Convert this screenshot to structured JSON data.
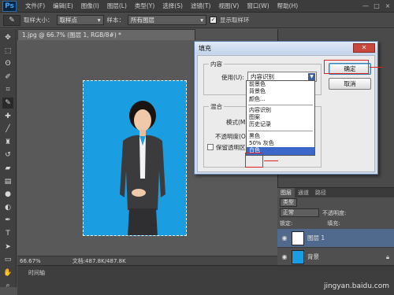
{
  "app": {
    "logo": "Ps",
    "menu": [
      "文件(F)",
      "编辑(E)",
      "图像(I)",
      "图层(L)",
      "类型(Y)",
      "选择(S)",
      "滤镜(T)",
      "视图(V)",
      "窗口(W)",
      "帮助(H)"
    ],
    "window_controls": [
      "—",
      "□",
      "×"
    ]
  },
  "options_bar": {
    "brush_size_label": "取样大小：",
    "brush_size_value": "取样点",
    "sample_label": "样本：",
    "sample_value": "所有图层",
    "show_ring_label": "显示取样环",
    "show_ring_checked": true
  },
  "document": {
    "tab_title": "1.jpg @ 66.7% (图层 1, RGB/8#) *",
    "zoom": "66.67%",
    "doc_info": "文档:487.8K/487.8K",
    "timeline_label": "时间轴"
  },
  "dialog": {
    "title": "填充",
    "content_group": "内容",
    "use_label": "使用(U):",
    "use_value": "内容识别",
    "blend_group": "混合",
    "mode_label": "模式(M):",
    "opacity_label": "不透明度(O):",
    "preserve_label": "保留透明区域",
    "ok_label": "确定",
    "cancel_label": "取消",
    "close_label": "✕",
    "dropdown_groups": [
      [
        "前景色",
        "背景色",
        "颜色..."
      ],
      [
        "内容识别",
        "图案",
        "历史记录"
      ],
      [
        "黑色",
        "50% 灰色",
        "白色"
      ]
    ],
    "selected_option": "白色"
  },
  "layers_panel": {
    "tabs": [
      "图层",
      "通道",
      "路径"
    ],
    "kind_label": "类型",
    "blend_mode": "正常",
    "opacity_label": "不透明度:",
    "lock_label": "锁定:",
    "fill_label": "填充:",
    "layers": [
      {
        "name": "图层 1",
        "selected": true
      },
      {
        "name": "背景",
        "selected": false
      }
    ]
  },
  "watermark": "jingyan.baidu.com",
  "colors": {
    "photo_background": "#1b9ee1",
    "selected_option": "#3b67c9",
    "annotation_red": "#e0211f"
  }
}
